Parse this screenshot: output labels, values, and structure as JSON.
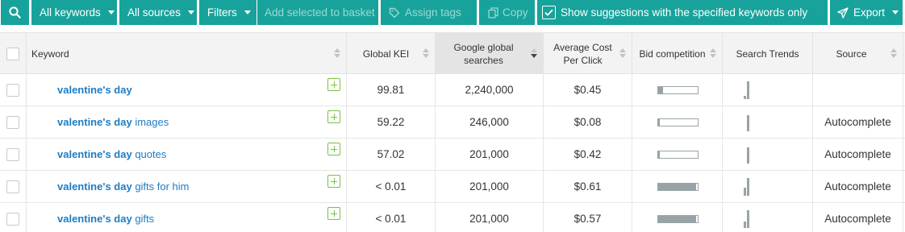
{
  "toolbar": {
    "keywords_label": "All keywords",
    "sources_label": "All sources",
    "filters_label": "Filters",
    "add_basket_label": "Add selected to basket",
    "assign_tags_label": "Assign tags",
    "copy_label": "Copy",
    "show_suggestions_label": "Show suggestions with the specified keywords only",
    "show_suggestions_checked": true,
    "export_label": "Export",
    "accent_color": "#17a39b"
  },
  "table": {
    "columns": {
      "keyword": "Keyword",
      "kei": "Global KEI",
      "searches": "Google global searches",
      "cpc": "Average Cost Per Click",
      "bid": "Bid competition",
      "trends": "Search Trends",
      "source": "Source"
    },
    "sorted_column": "searches",
    "sort_direction": "descending",
    "rows": [
      {
        "keyword_bold": "valentine's day",
        "keyword_rest": "",
        "kei": "99.81",
        "searches": "2,240,000",
        "cpc": "$0.45",
        "bid_competition": 0.12,
        "trend": [
          0.2,
          1.0
        ],
        "source": ""
      },
      {
        "keyword_bold": "valentine's day",
        "keyword_rest": " images",
        "kei": "59.22",
        "searches": "246,000",
        "cpc": "$0.08",
        "bid_competition": 0.02,
        "trend": [
          0,
          0.9
        ],
        "source": "Autocomplete"
      },
      {
        "keyword_bold": "valentine's day",
        "keyword_rest": " quotes",
        "kei": "57.02",
        "searches": "201,000",
        "cpc": "$0.42",
        "bid_competition": 0.02,
        "trend": [
          0,
          0.9
        ],
        "source": "Autocomplete"
      },
      {
        "keyword_bold": "valentine's day",
        "keyword_rest": " gifts for him",
        "kei": "< 0.01",
        "searches": "201,000",
        "cpc": "$0.61",
        "bid_competition": 0.96,
        "trend": [
          0.45,
          1.0
        ],
        "source": "Autocomplete"
      },
      {
        "keyword_bold": "valentine's day",
        "keyword_rest": " gifts",
        "kei": "< 0.01",
        "searches": "201,000",
        "cpc": "$0.57",
        "bid_competition": 0.96,
        "trend": [
          0.35,
          1.0
        ],
        "source": "Autocomplete"
      }
    ]
  }
}
